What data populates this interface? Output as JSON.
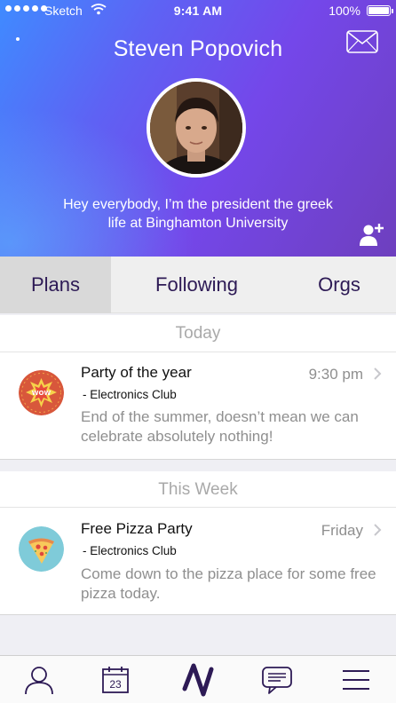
{
  "status_bar": {
    "carrier": "Sketch",
    "time": "9:41 AM",
    "battery": "100%",
    "battery_level": 1.0
  },
  "profile": {
    "name": "Steven Popovich",
    "bio": "Hey everybody, I’m the president the greek life at Binghamton University",
    "avatar": "user-avatar-photo"
  },
  "icons": {
    "mail": "envelope-icon",
    "add_friend": "add-person-icon",
    "menu_dot": "dot-menu-icon"
  },
  "tabs": [
    {
      "label": "Plans",
      "selected": true
    },
    {
      "label": "Following",
      "selected": false
    },
    {
      "label": "Orgs",
      "selected": false
    }
  ],
  "sections": [
    {
      "title": "Today",
      "plans": [
        {
          "title": "Party of the year",
          "org": "- Electronics Club",
          "time": "9:30 pm",
          "description": "End of the summer, doesn’t mean we can celebrate absolutely nothing!",
          "icon": "wow-comic-icon"
        }
      ]
    },
    {
      "title": "This Week",
      "plans": [
        {
          "title": "Free Pizza Party",
          "org": "- Electronics Club",
          "time": "Friday",
          "description": "Come down to the pizza place for some free pizza today.",
          "icon": "pizza-slice-icon"
        }
      ]
    }
  ],
  "bottom_nav": {
    "calendar_day": "23",
    "items": [
      "profile-icon",
      "calendar-icon",
      "app-logo-icon",
      "messages-icon",
      "hamburger-menu-icon"
    ]
  },
  "colors": {
    "accent_dark": "#2d1a55",
    "gradient_start": "#3f8bff",
    "gradient_end": "#6e3fbe"
  }
}
